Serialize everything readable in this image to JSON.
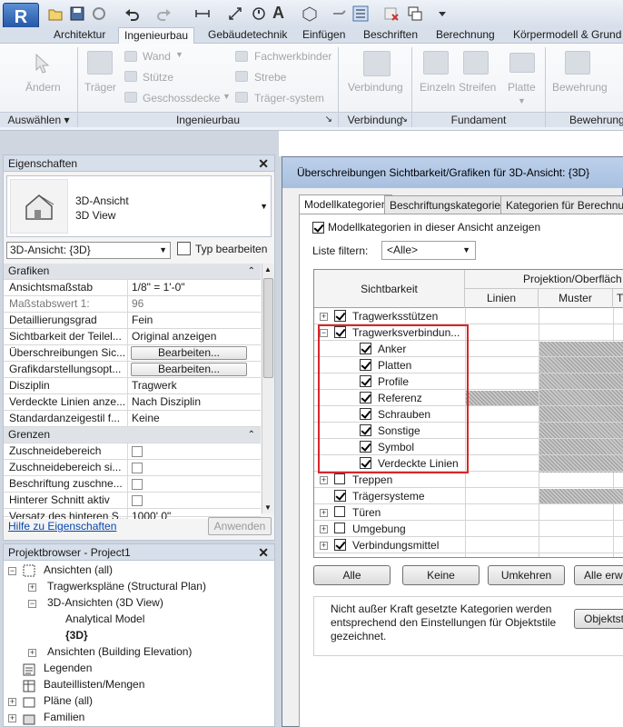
{
  "app": {
    "logo": "R"
  },
  "qat": {
    "icons": [
      "open-icon",
      "save-icon",
      "sync-icon",
      "undo-icon",
      "redo-icon",
      "measure-icon",
      "dimension-icon",
      "tag-icon",
      "text-icon",
      "3d-view-icon",
      "section-icon",
      "thin-lines-icon",
      "close-hidden-icon",
      "switch-windows-icon",
      "dropdown-icon"
    ]
  },
  "tabs": [
    "Architektur",
    "Ingenieurbau",
    "Gebäudetechnik",
    "Einfügen",
    "Beschriften",
    "Berechnung",
    "Körpermodell & Grund"
  ],
  "ribbon": {
    "modify": "Ändern",
    "beam": "Träger",
    "wall": "Wand",
    "column": "Stütze",
    "floor": "Geschossdecke",
    "truss": "Fachwerkbinder",
    "brace": "Strebe",
    "beam_system": "Träger-system",
    "connection": "Verbindung",
    "isolated": "Einzeln",
    "strip": "Streifen",
    "slab": "Platte",
    "rebar": "Bewehrung",
    "groups": {
      "select": "Auswählen",
      "structure": "Ingenieurbau",
      "connection": "Verbindung",
      "foundation": "Fundament",
      "reinforcement": "Bewehrung"
    }
  },
  "properties": {
    "title": "Eigenschaften",
    "type_name": "3D-Ansicht",
    "type_sub": "3D View",
    "instance_select": "3D-Ansicht: {3D}",
    "edit_type": "Typ bearbeiten",
    "group_graphics": "Grafiken",
    "rows_graphics": [
      {
        "label": "Ansichtsmaßstab",
        "value": "1/8\" = 1'-0\""
      },
      {
        "label": "Maßstabswert 1:",
        "value": "96"
      },
      {
        "label": "Detaillierungsgrad",
        "value": "Fein"
      },
      {
        "label": "Sichtbarkeit der Teilel...",
        "value": "Original anzeigen"
      },
      {
        "label": "Überschreibungen Sic...",
        "value": "Bearbeiten..."
      },
      {
        "label": "Grafikdarstellungsopt...",
        "value": "Bearbeiten..."
      },
      {
        "label": "Disziplin",
        "value": "Tragwerk"
      },
      {
        "label": "Verdeckte Linien anze...",
        "value": "Nach Disziplin"
      },
      {
        "label": "Standardanzeigestil f...",
        "value": "Keine"
      }
    ],
    "group_extents": "Grenzen",
    "rows_extents": [
      {
        "label": "Zuschneidebereich"
      },
      {
        "label": "Zuschneidebereich si..."
      },
      {
        "label": "Beschriftung zuschne..."
      },
      {
        "label": "Hinterer Schnitt aktiv"
      },
      {
        "label": "Versatz des hinteren S...",
        "value": "1000' 0\""
      }
    ],
    "help_link": "Hilfe zu Eigenschaften",
    "apply": "Anwenden"
  },
  "browser": {
    "title": "Projektbrowser - Project1",
    "nodes": [
      {
        "label": "Ansichten (all)"
      },
      {
        "label": "Tragwerkspläne (Structural Plan)"
      },
      {
        "label": "3D-Ansichten (3D View)"
      },
      {
        "label": "Analytical Model"
      },
      {
        "label": "{3D}"
      },
      {
        "label": "Ansichten (Building Elevation)"
      },
      {
        "label": "Legenden"
      },
      {
        "label": "Bauteillisten/Mengen"
      },
      {
        "label": "Pläne (all)"
      },
      {
        "label": "Familien"
      }
    ]
  },
  "dialog": {
    "title": "Überschreibungen Sichtbarkeit/Grafiken für 3D-Ansicht: {3D}",
    "tabs": [
      "Modellkategorien",
      "Beschriftungskategorien",
      "Kategorien für Berechnung"
    ],
    "show_checkbox": "Modellkategorien in dieser Ansicht anzeigen",
    "filter_label": "Liste filtern:",
    "filter_value": "<Alle>",
    "col_visibility": "Sichtbarkeit",
    "col_projection": "Projektion/Oberfläch",
    "col_lines": "Linien",
    "col_patterns": "Muster",
    "col_trans": "T",
    "rows": [
      {
        "label": "Tragwerksstützen",
        "checked": true,
        "level": 0,
        "expander": "+"
      },
      {
        "label": "Tragwerksverbindun...",
        "checked": true,
        "level": 0,
        "expander": "-"
      },
      {
        "label": "Anker",
        "checked": true,
        "level": 1
      },
      {
        "label": "Platten",
        "checked": true,
        "level": 1
      },
      {
        "label": "Profile",
        "checked": true,
        "level": 1
      },
      {
        "label": "Referenz",
        "checked": true,
        "level": 1
      },
      {
        "label": "Schrauben",
        "checked": true,
        "level": 1
      },
      {
        "label": "Sonstige",
        "checked": true,
        "level": 1
      },
      {
        "label": "Symbol",
        "checked": true,
        "level": 1
      },
      {
        "label": "Verdeckte Linien",
        "checked": true,
        "level": 1
      },
      {
        "label": "Treppen",
        "checked": false,
        "level": 0,
        "expander": "+"
      },
      {
        "label": "Trägersysteme",
        "checked": true,
        "level": 0,
        "expander": ""
      },
      {
        "label": "Türen",
        "checked": false,
        "level": 0,
        "expander": "+"
      },
      {
        "label": "Umgebung",
        "checked": false,
        "level": 0,
        "expander": "+"
      },
      {
        "label": "Verbindungsmittel",
        "checked": true,
        "level": 0,
        "expander": "+"
      }
    ],
    "buttons": {
      "all": "Alle",
      "none": "Keine",
      "invert": "Umkehren",
      "expand_all": "Alle erwe"
    },
    "note": "Nicht außer Kraft gesetzte Kategorien werden entsprechend den Einstellungen für Objektstile gezeichnet.",
    "note_lines": [
      "Nicht außer Kraft gesetzte Kategorien werden",
      "entsprechend den Einstellungen für Objektstile",
      "gezeichnet."
    ],
    "object_styles": "Objektstile..."
  },
  "colors": {
    "highlight": "#d9262a",
    "titlebar": "#a8c0e0"
  }
}
